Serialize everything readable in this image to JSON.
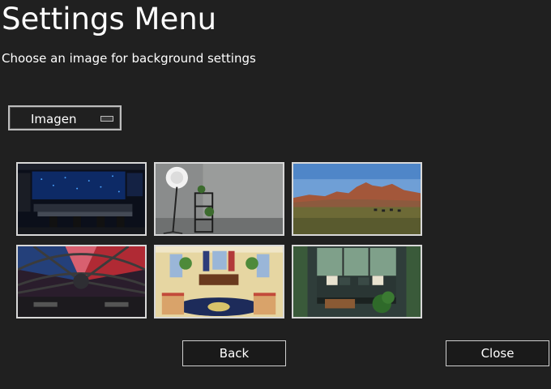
{
  "header": {
    "title": "Settings Menu",
    "subtitle": "Choose an image for background settings"
  },
  "dropdown": {
    "selected": "Imagen"
  },
  "thumbnails": [
    {
      "name": "thumb-control-room",
      "icon": "control-room-scene"
    },
    {
      "name": "thumb-studio-wall",
      "icon": "studio-light-scene"
    },
    {
      "name": "thumb-desert-mesa",
      "icon": "desert-landscape-scene"
    },
    {
      "name": "thumb-spaceship-cockpit",
      "icon": "cockpit-scene"
    },
    {
      "name": "thumb-oval-office",
      "icon": "oval-office-scene"
    },
    {
      "name": "thumb-living-room",
      "icon": "living-room-scene"
    }
  ],
  "buttons": {
    "back": "Back",
    "close": "Close"
  }
}
